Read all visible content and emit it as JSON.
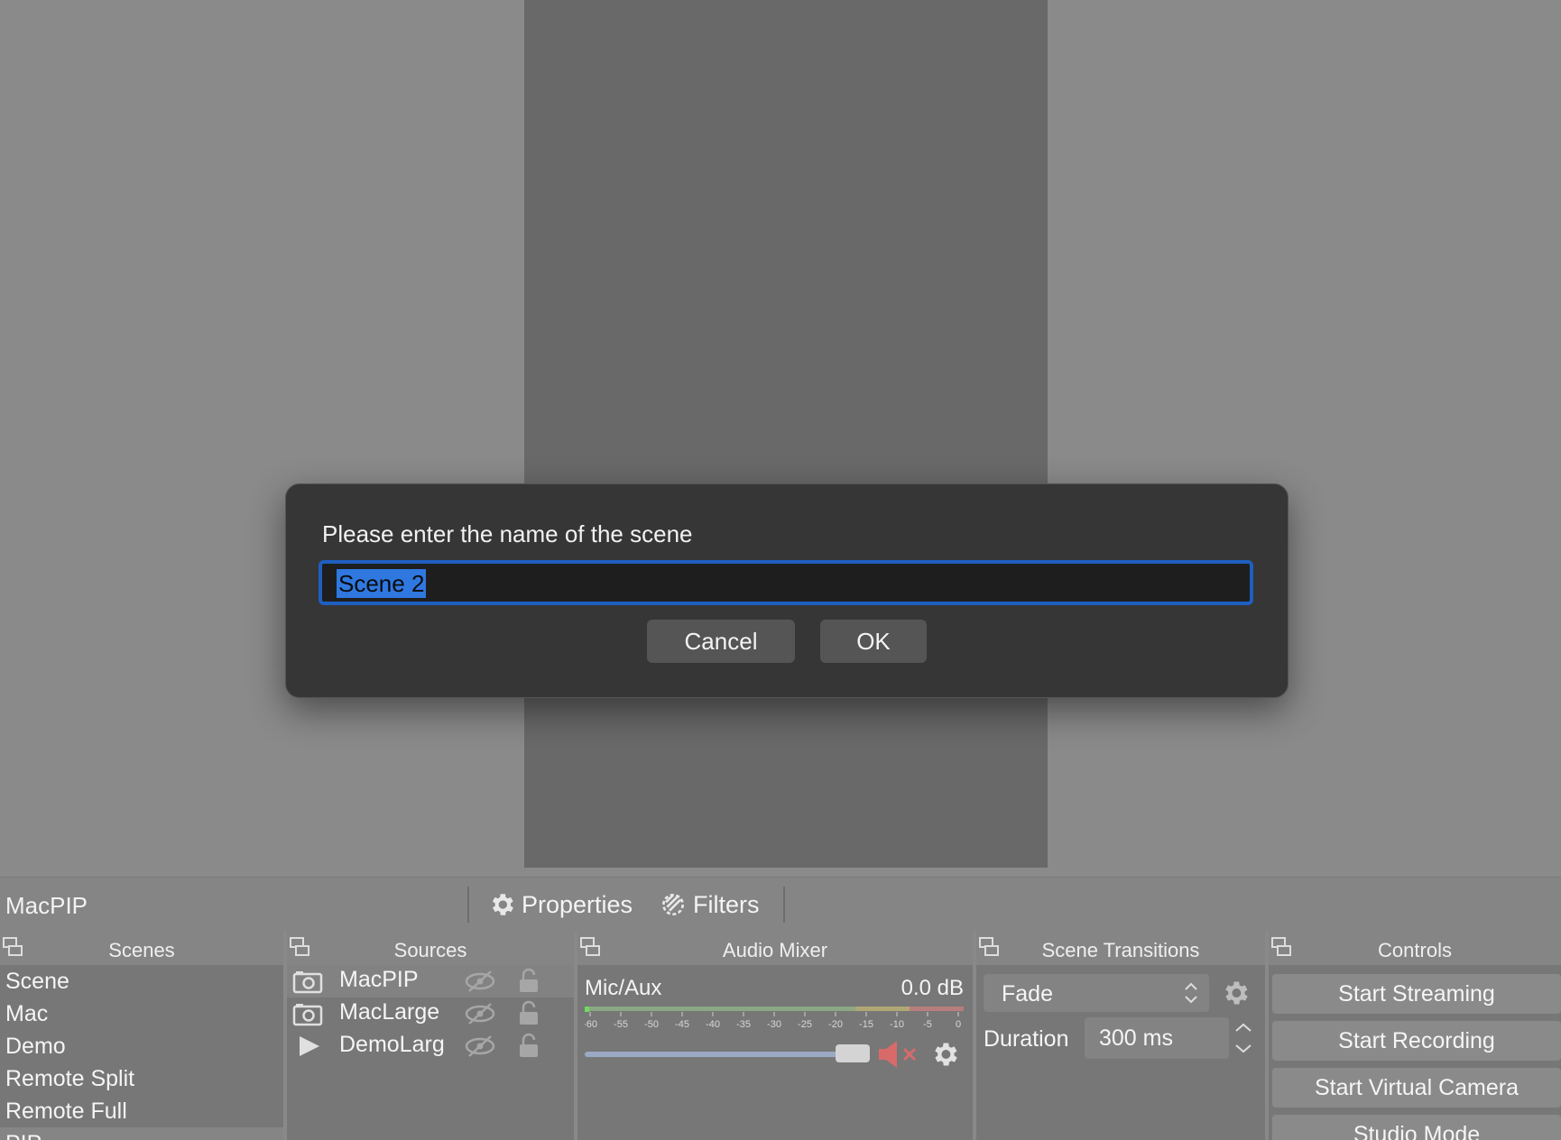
{
  "toolbar": {
    "source_name": "MacPIP",
    "properties_label": "Properties",
    "filters_label": "Filters"
  },
  "docks": {
    "scenes_title": "Scenes",
    "sources_title": "Sources",
    "mixer_title": "Audio Mixer",
    "transitions_title": "Scene Transitions",
    "controls_title": "Controls"
  },
  "scenes": [
    "Scene",
    "Mac",
    "Demo",
    "Remote Split",
    "Remote Full",
    "PIP"
  ],
  "sources": [
    {
      "label": "MacPIP",
      "icon": "camera-icon"
    },
    {
      "label": "MacLarge",
      "icon": "camera-icon"
    },
    {
      "label": "DemoLarg",
      "icon": "play-icon"
    }
  ],
  "mixer": {
    "channel": "Mic/Aux",
    "level": "0.0 dB",
    "meter_ticks": [
      "-60",
      "-55",
      "-50",
      "-45",
      "-40",
      "-35",
      "-30",
      "-25",
      "-20",
      "-15",
      "-10",
      "-5",
      "0"
    ],
    "volume_fraction": 1.0,
    "muted": true
  },
  "transitions": {
    "selected": "Fade",
    "duration_label": "Duration",
    "duration_value": "300 ms"
  },
  "controls": {
    "start_streaming": "Start Streaming",
    "start_recording": "Start Recording",
    "start_virtual_camera": "Start Virtual Camera",
    "studio_mode": "Studio Mode"
  },
  "dialog": {
    "prompt": "Please enter the name of the scene",
    "value": "Scene 2",
    "cancel_label": "Cancel",
    "ok_label": "OK"
  },
  "colors": {
    "accent": "#1e5fc0",
    "selection": "#2f78e0",
    "mute_red": "#d86a6a"
  }
}
